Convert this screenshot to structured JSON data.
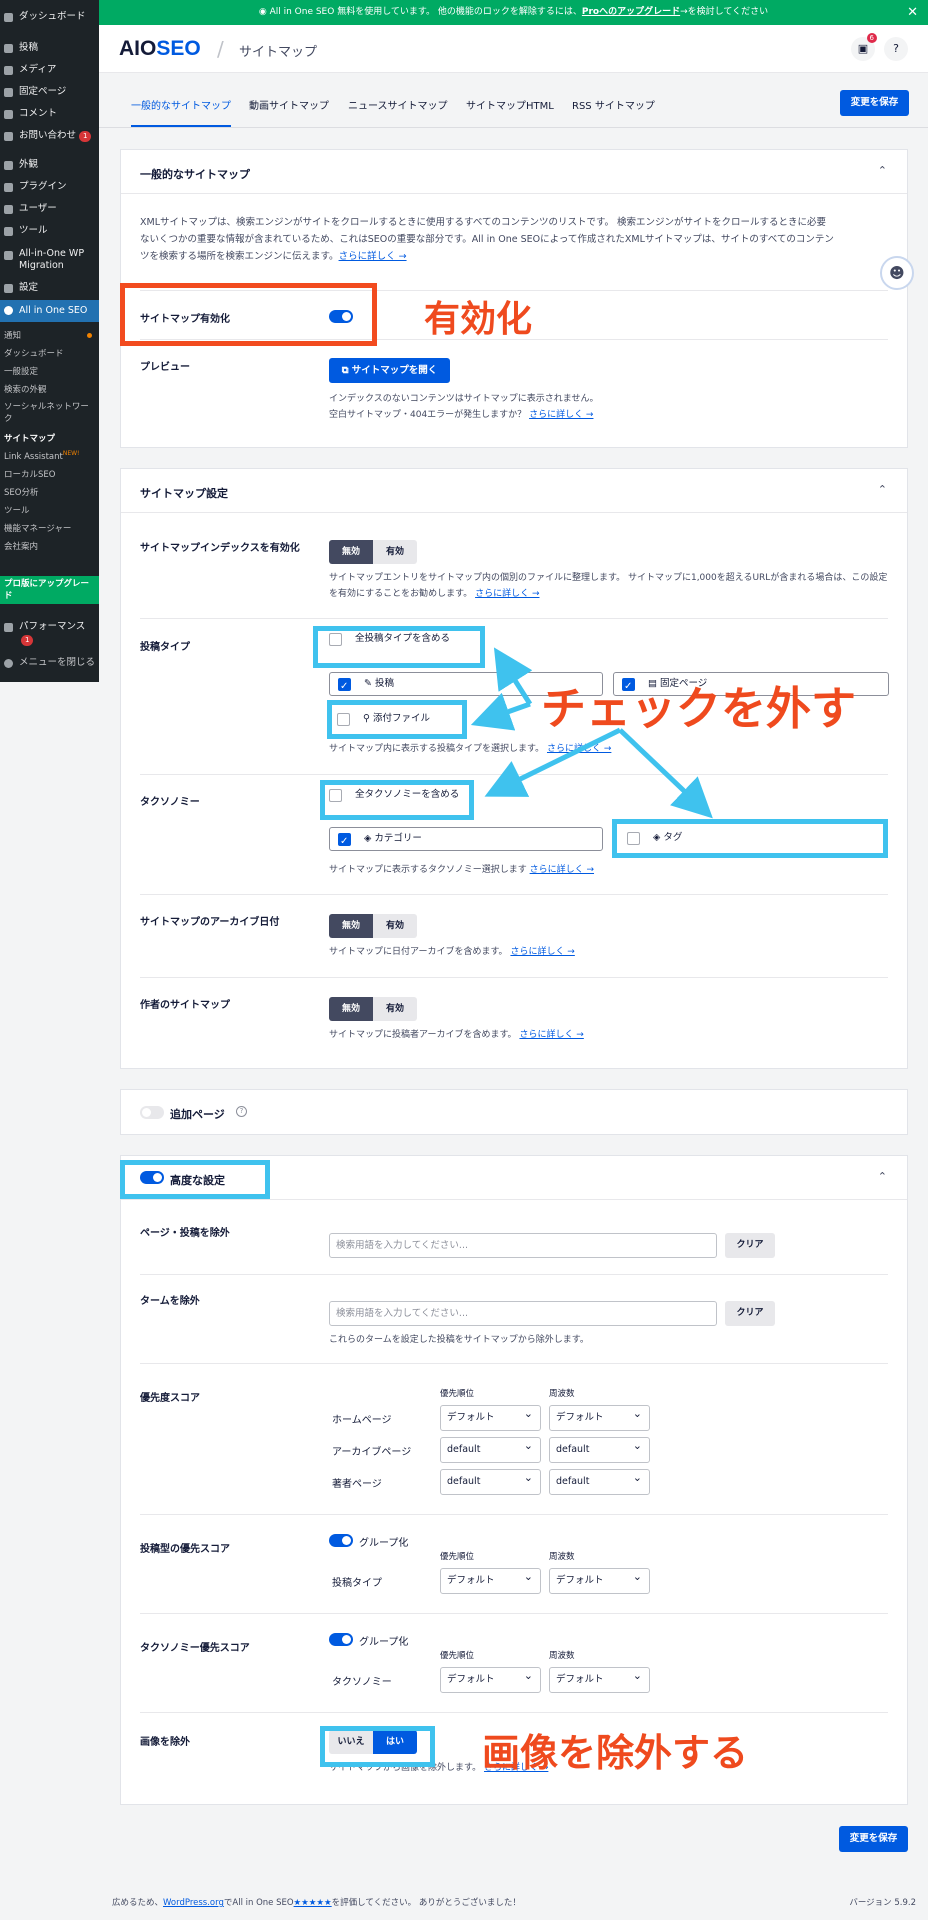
{
  "sidebar": {
    "items": [
      {
        "label": "ダッシュボード"
      },
      {
        "label": "投稿"
      },
      {
        "label": "メディア"
      },
      {
        "label": "固定ページ"
      },
      {
        "label": "コメント"
      },
      {
        "label": "お問い合わせ",
        "badge": "1"
      },
      {
        "label": "外観"
      },
      {
        "label": "プラグイン"
      },
      {
        "label": "ユーザー"
      },
      {
        "label": "ツール"
      },
      {
        "label": "All-in-One WP Migration"
      },
      {
        "label": "設定"
      },
      {
        "label": "All in One SEO"
      }
    ],
    "sub": [
      "通知",
      "ダッシュボード",
      "一般設定",
      "検索の外観",
      "ソーシャルネットワーク",
      "サイトマップ",
      "Link Assistant",
      "ローカルSEO",
      "SEO分析",
      "ツール",
      "機能マネージャー",
      "会社案内"
    ],
    "new_badge": "NEW!",
    "pro": "プロ版にアップグレード",
    "performance": "パフォーマンス",
    "performance_badge": "1",
    "collapse": "メニューを閉じる"
  },
  "topbar": {
    "text1": "All in One SEO 無料を使用しています。 他の機能のロックを解除するには、",
    "link": "Proへのアップグレード",
    "text2": "→を検討してください"
  },
  "header": {
    "logo_a": "AIO",
    "logo_b": "SEO",
    "title": "サイトマップ",
    "notif_count": "6"
  },
  "tabs": [
    "一般的なサイトマップ",
    "動画サイトマップ",
    "ニュースサイトマップ",
    "サイトマップHTML",
    "RSS サイトマップ"
  ],
  "save_label": "変更を保存",
  "general": {
    "title": "一般的なサイトマップ",
    "desc1": "XMLサイトマップは、検索エンジンがサイトをクロールするときに使用するすべてのコンテンツのリストです。 検索エンジンがサイトをクロールするときに必要",
    "desc2": "ないくつかの重要な情報が含まれているため、これはSEOの重要な部分です。All in One SEOによって作成されたXMLサイトマップは、サイトのすべてのコンテン",
    "desc3": "ツを検索する場所を検索エンジンに伝えます。",
    "more": "さらに詳しく →",
    "enable_label": "サイトマップ有効化",
    "preview_label": "プレビュー",
    "open_btn": "サイトマップを開く",
    "note1": "インデックスのないコンテンツはサイトマップに表示されません。",
    "note2": "空白サイトマップ・404エラーが発生しますか？"
  },
  "settings": {
    "title": "サイトマップ設定",
    "index_label": "サイトマップインデックスを有効化",
    "off": "無効",
    "on": "有効",
    "index_desc1": "サイトマップエントリをサイトマップ内の個別のファイルに整理します。 サイトマップに1,000を超えるURLが含まれる場合は、この設定",
    "index_desc2": "を有効にすることをお勧めします。",
    "post_types_label": "投稿タイプ",
    "all_post_types": "全投稿タイプを含める",
    "post": "投稿",
    "page": "固定ページ",
    "attachment": "添付ファイル",
    "post_types_desc": "サイトマップ内に表示する投稿タイプを選択します。",
    "tax_label": "タクソノミー",
    "all_tax": "全タクソノミーを含める",
    "category": "カテゴリー",
    "tag": "タグ",
    "tax_desc": "サイトマップに表示するタクソノミー選択します",
    "archive_label": "サイトマップのアーカイブ日付",
    "archive_desc": "サイトマップに日付アーカイブを含めます。",
    "author_label": "作者のサイトマップ",
    "author_desc": "サイトマップに投稿者アーカイブを含めます。"
  },
  "additional": {
    "label": "追加ページ"
  },
  "advanced": {
    "title": "高度な設定",
    "exclude_posts_label": "ページ・投稿を除外",
    "search_placeholder": "検索用語を入力してください...",
    "clear": "クリア",
    "exclude_terms_label": "タームを除外",
    "exclude_terms_desc": "これらのタームを設定した投稿をサイトマップから除外します。",
    "priority_label": "優先度スコア",
    "col_priority": "優先順位",
    "col_freq": "周波数",
    "home": "ホームページ",
    "archive": "アーカイブページ",
    "author": "著者ページ",
    "default_ja": "デフォルト",
    "default_en": "default",
    "pt_priority_label": "投稿型の優先スコア",
    "grouping": "グループ化",
    "post_types": "投稿タイプ",
    "tax_priority_label": "タクソノミー優先スコア",
    "taxonomy": "タクソノミー",
    "exclude_images_label": "画像を除外",
    "no": "いいえ",
    "yes": "はい",
    "exclude_images_desc": "サイトマップから画像を除外します。"
  },
  "annotations": {
    "enable": "有効化",
    "uncheck": "チェックを外す",
    "exclude_images": "画像を除外する"
  },
  "colors": {
    "annotation_red": "#f24b1f",
    "annotation_cyan": "#3fc2ee",
    "brand_blue": "#005ae0",
    "brand_green": "#00aa63"
  },
  "footer": {
    "pre": "広めるため、",
    "wp": "WordPress.org",
    "mid": "でAll in One SEO",
    "stars": "★★★★★",
    "post": "を評価してください。 ありがとうございました！",
    "version": "バージョン 5.9.2"
  }
}
